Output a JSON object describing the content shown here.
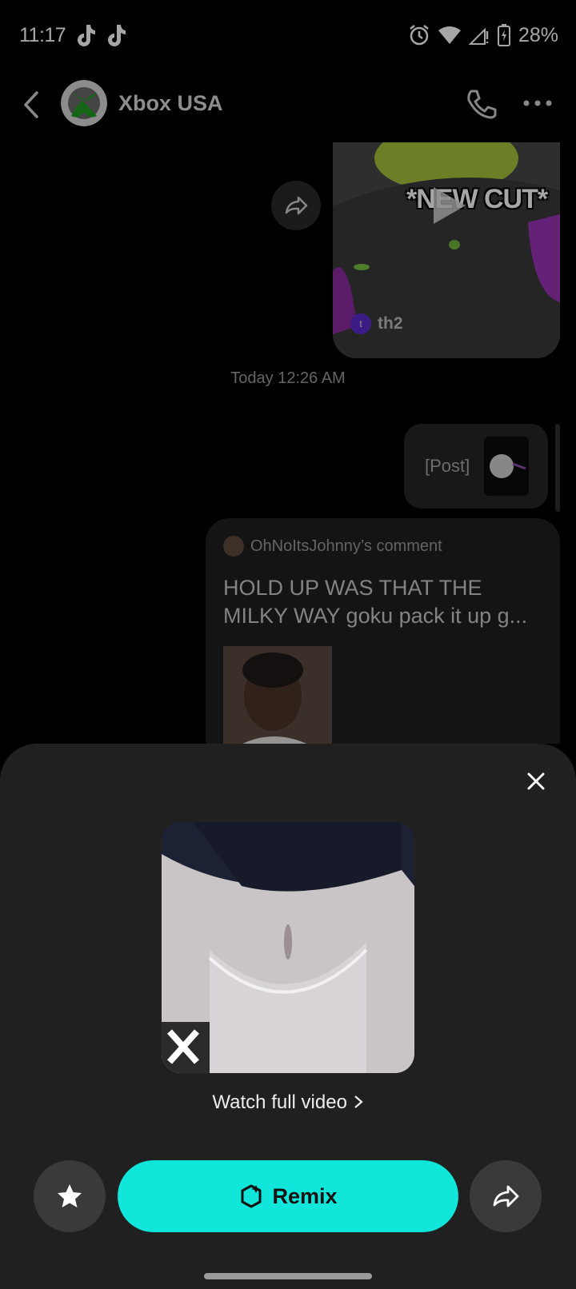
{
  "status_bar": {
    "time": "11:17",
    "battery": "28%",
    "icons": [
      "tiktok-icon",
      "tiktok-icon",
      "alarm-icon",
      "wifi-icon",
      "signal-icon",
      "battery-icon"
    ]
  },
  "header": {
    "contact_name": "Xbox USA",
    "icons": [
      "back-icon",
      "xbox-logo",
      "phone-icon",
      "more-icon"
    ]
  },
  "chat": {
    "video_message": {
      "overlay_text": "*NEW CUT*",
      "author": "th2",
      "author_initial": "t"
    },
    "timestamp": "Today 12:26 AM",
    "post_message": {
      "label": "[Post]"
    },
    "comment_message": {
      "header": "OhNoItsJohnny’s comment",
      "text": "HOLD UP WAS THAT THE MILKY WAY goku pack it up g..."
    }
  },
  "sheet": {
    "watch_full_video": "Watch full video",
    "remix_label": "Remix",
    "icons": [
      "close-icon",
      "star-icon",
      "remix-icon",
      "share-icon"
    ]
  },
  "colors": {
    "background": "#000000",
    "sheet": "#202020",
    "accent": "#10e6d9",
    "bubble": "#262626"
  }
}
